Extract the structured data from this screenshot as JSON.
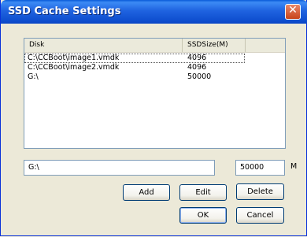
{
  "window": {
    "title": "SSD Cache Settings"
  },
  "list": {
    "columns": [
      "Disk",
      "SSDSize(M)"
    ],
    "rows": [
      {
        "disk": "C:\\CCBoot\\image1.vmdk",
        "size": "4096"
      },
      {
        "disk": "C:\\CCBoot\\image2.vmdk",
        "size": "4096"
      },
      {
        "disk": "G:\\",
        "size": "50000"
      }
    ]
  },
  "form": {
    "path_value": "G:\\",
    "size_value": "50000",
    "unit": "M"
  },
  "buttons": {
    "add": "Add",
    "edit": "Edit",
    "delete": "Delete",
    "ok": "OK",
    "cancel": "Cancel"
  }
}
